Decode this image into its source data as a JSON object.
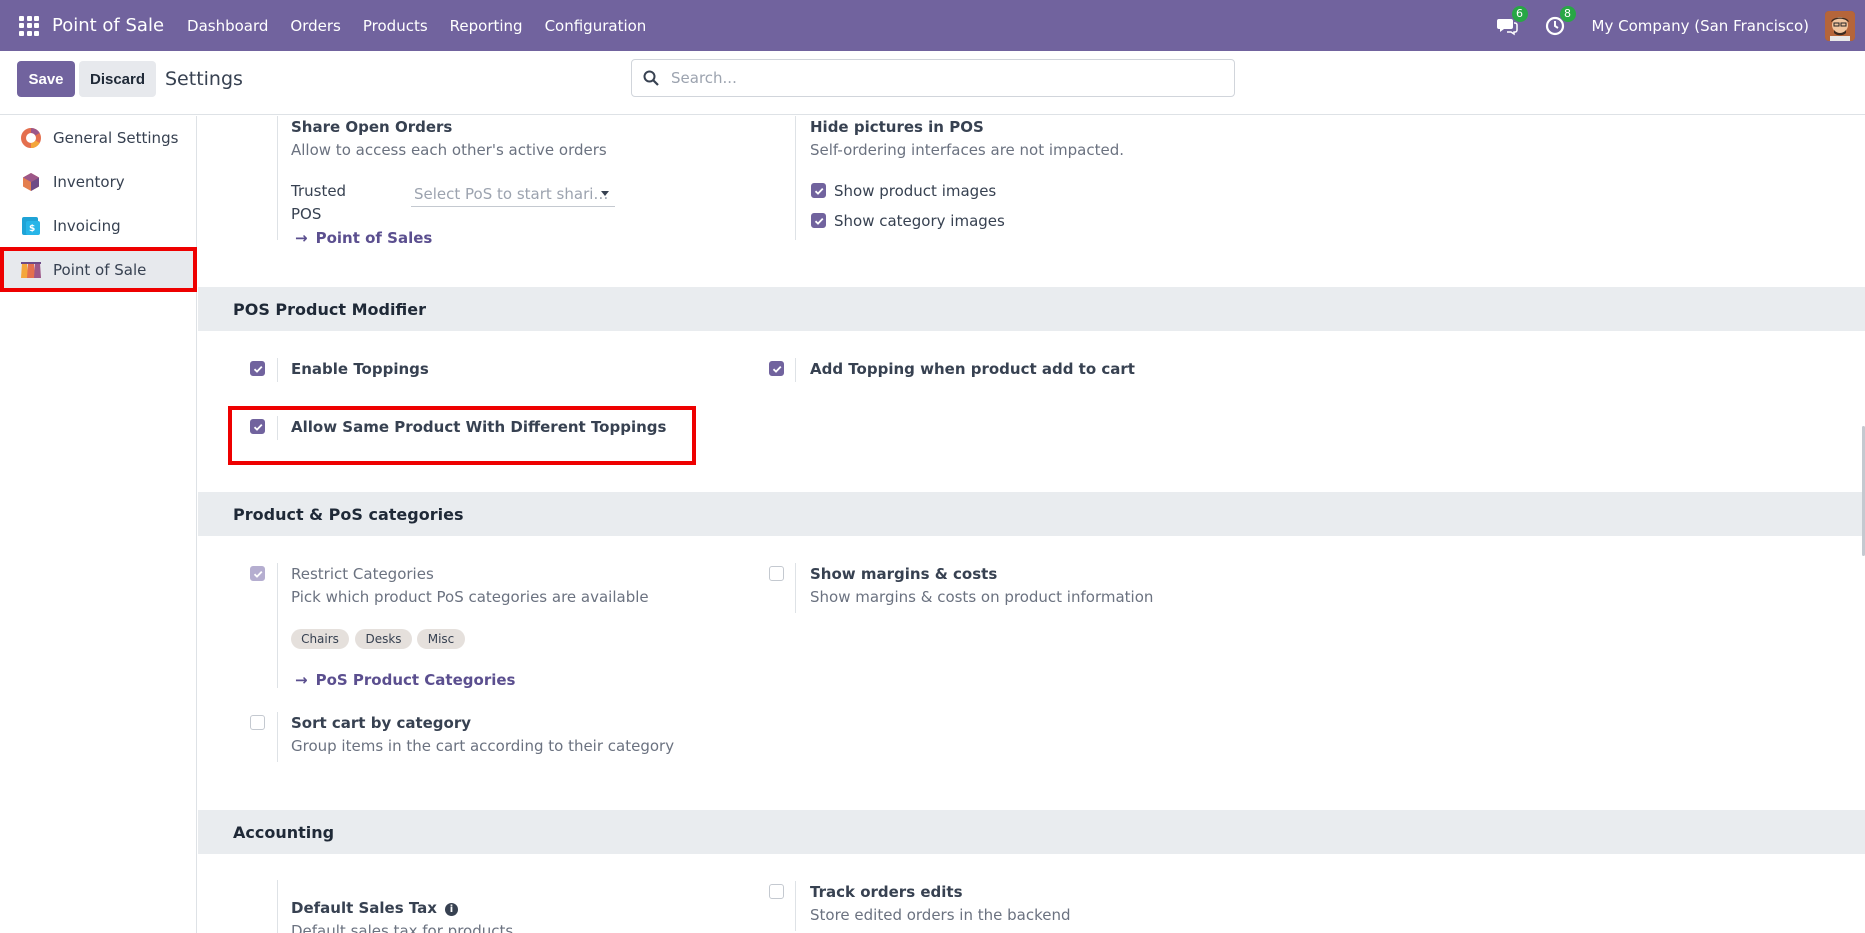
{
  "navbar": {
    "brand": "Point of Sale",
    "menu": [
      "Dashboard",
      "Orders",
      "Products",
      "Reporting",
      "Configuration"
    ],
    "messages_count": "6",
    "activities_count": "8",
    "company": "My Company (San Francisco)"
  },
  "control": {
    "save_label": "Save",
    "discard_label": "Discard",
    "title": "Settings",
    "search_placeholder": "Search..."
  },
  "sidebar": {
    "items": [
      {
        "label": "General Settings",
        "icon": "odoo-logo-icon"
      },
      {
        "label": "Inventory",
        "icon": "inventory-icon"
      },
      {
        "label": "Invoicing",
        "icon": "invoicing-icon"
      },
      {
        "label": "Point of Sale",
        "icon": "point-of-sale-icon",
        "active": true
      }
    ]
  },
  "settings": {
    "share_orders": {
      "title": "Share Open Orders",
      "desc": "Allow to access each other's active orders",
      "trusted_label_1": "Trusted",
      "trusted_label_2": "POS",
      "select_placeholder": "Select PoS to start shari…",
      "link": "Point of Sales"
    },
    "hide_pictures": {
      "title": "Hide pictures in POS",
      "desc": "Self-ordering interfaces are not impacted.",
      "opt1": "Show product images",
      "opt2": "Show category images"
    },
    "modifier": {
      "header": "POS Product Modifier",
      "enable_toppings": "Enable Toppings",
      "add_topping": "Add Topping when product add to cart",
      "allow_same": "Allow Same Product With Different Toppings"
    },
    "categories": {
      "header": "Product & PoS categories",
      "restrict_title": "Restrict Categories",
      "restrict_desc": "Pick which product PoS categories are available",
      "tags": [
        "Chairs",
        "Desks",
        "Misc"
      ],
      "link": "PoS Product Categories",
      "margins_title": "Show margins & costs",
      "margins_desc": "Show margins & costs on product information",
      "sort_title": "Sort cart by category",
      "sort_desc": "Group items in the cart according to their category"
    },
    "accounting": {
      "header": "Accounting",
      "tax_title": "Default Sales Tax",
      "tax_desc": "Default sales tax for products",
      "track_title": "Track orders edits",
      "track_desc": "Store edited orders in the backend"
    }
  },
  "colors": {
    "brand": "#71639e",
    "highlight": "#ee0000"
  }
}
